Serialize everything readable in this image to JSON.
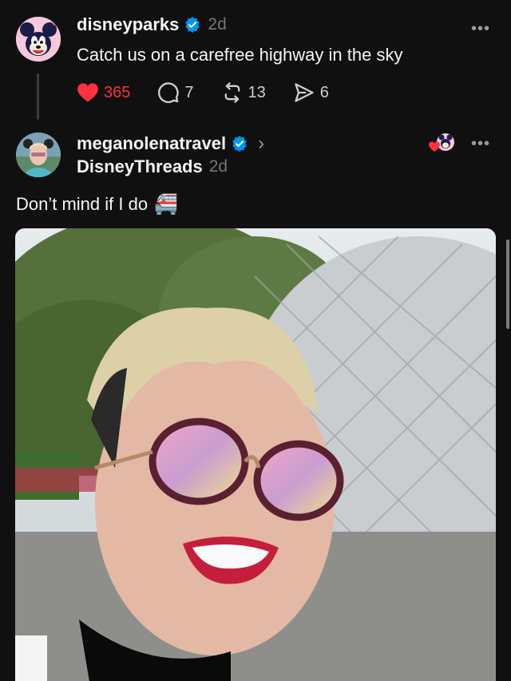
{
  "post1": {
    "username": "disneyparks",
    "time": "2d",
    "text": "Catch us on a carefree highway in the sky",
    "likes": "365",
    "replies": "7",
    "reposts": "13",
    "shares": "6",
    "avatar_icon": "mickey-avatar-icon",
    "colors": {
      "like": "#ff3040",
      "verified": "#0095f6"
    }
  },
  "post2": {
    "username": "meganolenatravel",
    "subtitle": "DisneyThreads",
    "time": "2d",
    "text": "Don’t mind if I do",
    "emoji": "🚝",
    "photo_alt_icon": "selfie-photo-icon"
  },
  "more_label": "•••",
  "chevron": "›"
}
